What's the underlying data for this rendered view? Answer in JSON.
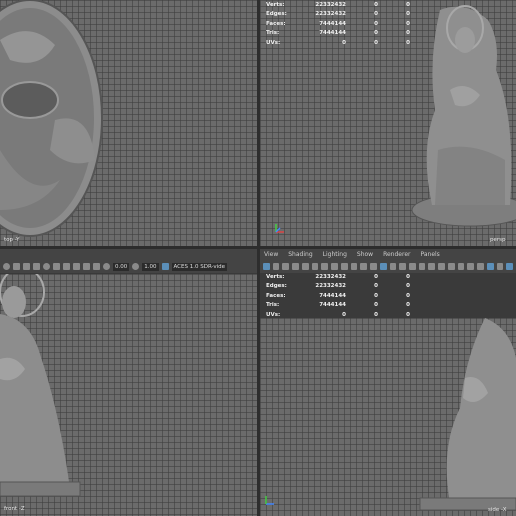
{
  "viewports": {
    "top": {
      "label": "top -Y"
    },
    "persp": {
      "label": "persp"
    },
    "front": {
      "label": "front -Z"
    },
    "side": {
      "label": "side -X"
    }
  },
  "hud": {
    "rows": [
      {
        "label": "Verts:",
        "v1": "22332432",
        "v2": "0",
        "v3": "0"
      },
      {
        "label": "Edges:",
        "v1": "22332432",
        "v2": "0",
        "v3": "0"
      },
      {
        "label": "Faces:",
        "v1": "7444144",
        "v2": "0",
        "v3": "0"
      },
      {
        "label": "Tris:",
        "v1": "7444144",
        "v2": "0",
        "v3": "0"
      },
      {
        "label": "UVs:",
        "v1": "0",
        "v2": "0",
        "v3": "0"
      }
    ]
  },
  "menu": {
    "items": [
      "View",
      "Shading",
      "Lighting",
      "Show",
      "Renderer",
      "Panels"
    ]
  },
  "toolbar": {
    "field_a": "0.00",
    "field_b": "1.00",
    "colorspace": "ACES 1.0 SDR-vide"
  },
  "colors": {
    "grid_bg": "#6b6b6b",
    "panel_bg": "#444444",
    "accent": "#5b8fb9"
  }
}
